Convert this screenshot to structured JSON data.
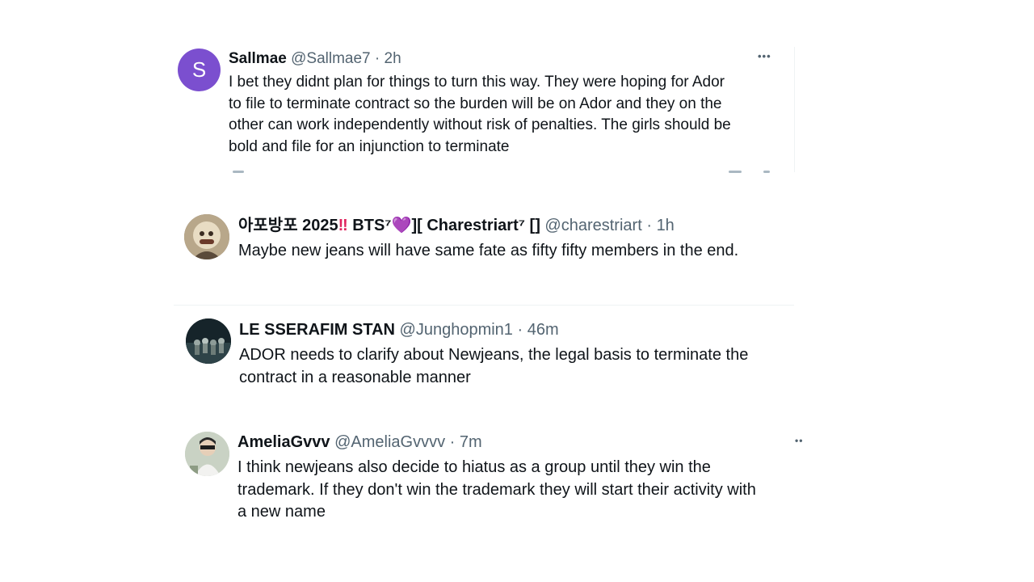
{
  "colors": {
    "accent_purple": "#7b4fcf",
    "secondary_text": "#536471",
    "primary_text": "#0f1419"
  },
  "tweets": [
    {
      "avatar_letter": "S",
      "name": "Sallmae",
      "handle": "@Sallmae7",
      "separator": "·",
      "time": "2h",
      "more": "•••",
      "lines": [
        "I bet they didnt plan for things to turn this way.  They were hoping for Ador",
        "to file to terminate contract so the burden will be on Ador and they on the",
        "other can work independently without risk of penalties.  The girls  should be",
        "bold and file for an injunction to terminate"
      ]
    },
    {
      "avatar_icon": "user-photo-avatar",
      "name_part1": "아포방포 2025",
      "name_part2": "‼",
      "name_part3": " BTS⁷",
      "name_part4": "💜",
      "name_part5": "][ Charestriart⁷ []",
      "handle": "@charestriart",
      "separator": "·",
      "time": "1h",
      "lines": [
        "Maybe new jeans will have same fate as fifty fifty members in the end."
      ]
    },
    {
      "avatar_icon": "user-photo-avatar",
      "name": "LE SSERAFIM STAN",
      "handle": "@Junghopmin1",
      "separator": "·",
      "time": "46m",
      "lines": [
        "ADOR needs to clarify about Newjeans, the legal basis to terminate the",
        "contract in a reasonable manner"
      ]
    },
    {
      "avatar_icon": "user-photo-avatar",
      "name": "AmeliaGvvv",
      "handle": "@AmeliaGvvvv",
      "separator": "·",
      "time": "7m",
      "more": "••",
      "lines": [
        "I think newjeans also decide to hiatus as a group until they win the",
        "trademark. If they don't win the trademark they will start their activity with",
        "a new name"
      ]
    }
  ]
}
